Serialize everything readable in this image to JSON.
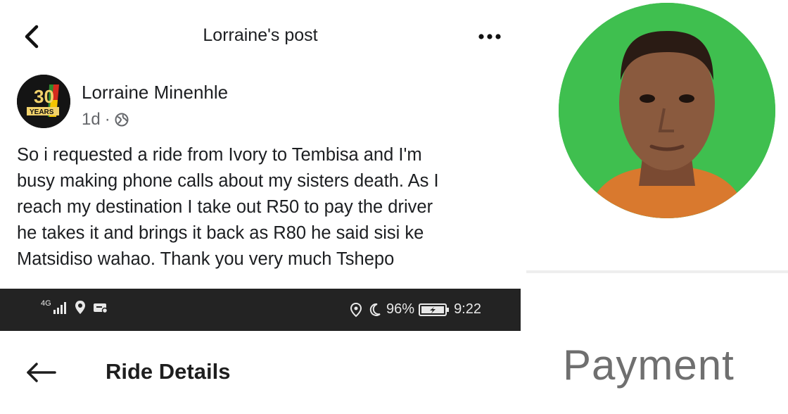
{
  "post_header": {
    "title": "Lorraine's post",
    "back_icon": "chevron-left-icon",
    "more_icon": "more-dots-icon"
  },
  "post": {
    "author": "Lorraine Minenhle",
    "avatar_logo_number": "30",
    "avatar_logo_text": "YEARS",
    "time": "1d",
    "separator": "·",
    "privacy_icon": "globe-icon",
    "body_lines": [
      "So i requested a ride from Ivory to Tembisa and I'm",
      "busy making phone calls about my sisters death. As I",
      "reach my destination I take out R50 to pay the driver",
      "he takes it and brings it back as R80 he said sisi ke",
      "Matsidiso wahao. Thank you very much Tshepo"
    ]
  },
  "status_bar": {
    "network": "4G",
    "battery": "96%",
    "time": "9:22"
  },
  "ride_details": {
    "back_icon": "arrow-left-icon",
    "title": "Ride Details"
  },
  "payment": {
    "label": "Payment"
  },
  "colors": {
    "status_bar_bg": "#232323",
    "profile_bg": "#3fbf4f",
    "meta_text": "#65676b"
  }
}
